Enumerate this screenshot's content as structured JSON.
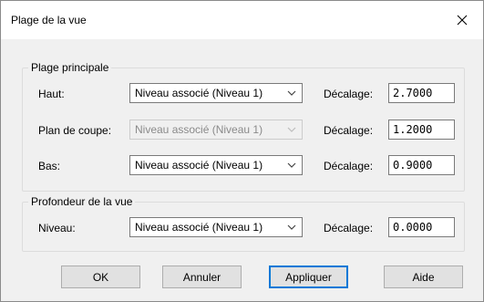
{
  "dialog": {
    "title": "Plage de la vue"
  },
  "primary": {
    "legend": "Plage principale",
    "rows": {
      "top": {
        "label": "Haut:",
        "level": "Niveau associé (Niveau 1)",
        "offset_label": "Décalage:",
        "offset": "2.7000"
      },
      "cut": {
        "label": "Plan de coupe:",
        "level": "Niveau associé (Niveau 1)",
        "offset_label": "Décalage:",
        "offset": "1.2000"
      },
      "bottom": {
        "label": "Bas:",
        "level": "Niveau associé (Niveau 1)",
        "offset_label": "Décalage:",
        "offset": "0.9000"
      }
    }
  },
  "depth": {
    "legend": "Profondeur de la vue",
    "row": {
      "label": "Niveau:",
      "level": "Niveau associé (Niveau 1)",
      "offset_label": "Décalage:",
      "offset": "0.0000"
    }
  },
  "buttons": {
    "ok": "OK",
    "cancel": "Annuler",
    "apply": "Appliquer",
    "help": "Aide"
  },
  "icons": {
    "close": "close-icon",
    "dropdown": "chevron-down-icon"
  },
  "colors": {
    "focus_border": "#0078d7",
    "button_face": "#e1e1e1",
    "dialog_bg": "#f0f0f0"
  }
}
